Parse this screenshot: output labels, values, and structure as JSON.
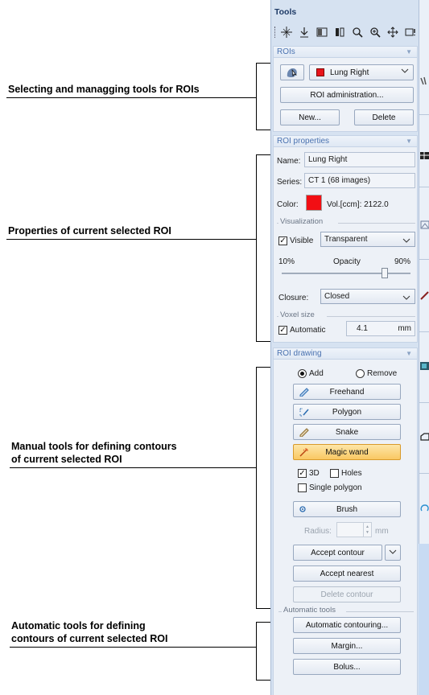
{
  "annotations": [
    {
      "text": "Selecting and managging tools for ROIs"
    },
    {
      "text": "Properties of current selected ROI"
    },
    {
      "text": "Manual tools for defining contours"
    },
    {
      "text": "of current selected ROI"
    },
    {
      "text": "Automatic tools for defining"
    },
    {
      "text": "contours of current selected ROI"
    }
  ],
  "panel": {
    "title": "Tools",
    "toolbar_icons": [
      "crosshair-icon",
      "move-point-icon",
      "window-level-icon",
      "split-view-icon",
      "zoom-icon",
      "zoom-region-icon",
      "pan-icon",
      "layout-icon"
    ]
  },
  "rois": {
    "header": "ROIs",
    "selected_roi": "Lung Right",
    "roi_color": "#e8141b",
    "admin_label": "ROI administration...",
    "new_label": "New...",
    "delete_label": "Delete"
  },
  "roi_properties": {
    "header": "ROI properties",
    "name_label": "Name:",
    "name_value": "Lung Right",
    "series_label": "Series:",
    "series_value": "CT 1 (68 images)",
    "color_label": "Color:",
    "color_value": "#f20f14",
    "volume": "Vol.[ccm]: 2122.0",
    "visualization_group": "Visualization",
    "visible_label": "Visible",
    "visible_checked": true,
    "display_mode": "Transparent",
    "opacity_min": "10%",
    "opacity_label": "Opacity",
    "opacity_max": "90%",
    "opacity_value": 0.8,
    "closure_label": "Closure:",
    "closure_value": "Closed",
    "voxel_group": "Voxel size",
    "automatic_label": "Automatic",
    "automatic_checked": true,
    "voxel_value": "4.1",
    "voxel_unit": "mm"
  },
  "roi_drawing": {
    "header": "ROI drawing",
    "add_label": "Add",
    "remove_label": "Remove",
    "freehand_label": "Freehand",
    "polygon_label": "Polygon",
    "snake_label": "Snake",
    "magic_wand_label": "Magic wand",
    "three_d_label": "3D",
    "holes_label": "Holes",
    "single_polygon_label": "Single polygon",
    "brush_label": "Brush",
    "radius_label": "Radius:",
    "radius_unit": "mm",
    "accept_contour_label": "Accept contour",
    "accept_nearest_label": "Accept nearest",
    "delete_contour_label": "Delete contour",
    "automatic_tools_group": "Automatic tools",
    "auto_contouring_label": "Automatic contouring...",
    "margin_label": "Margin...",
    "bolus_label": "Bolus..."
  }
}
